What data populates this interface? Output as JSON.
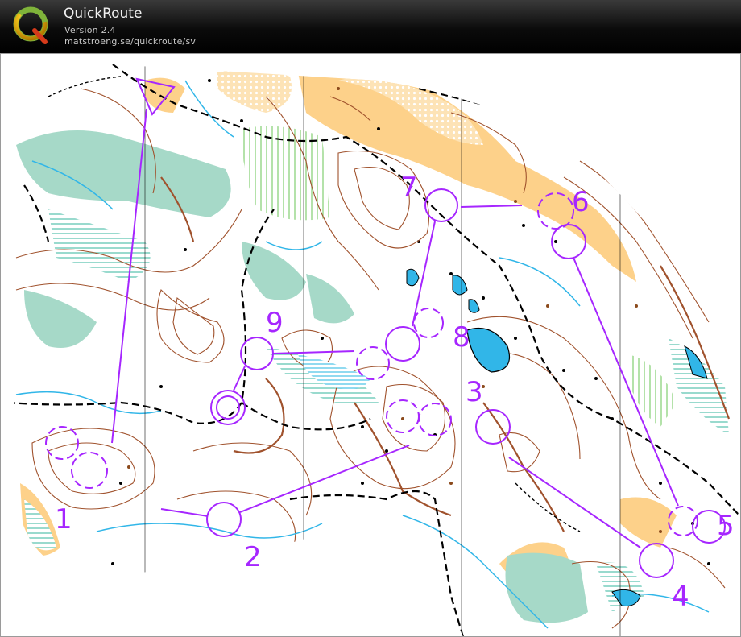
{
  "app": {
    "title": "QuickRoute",
    "version": "Version 2.4",
    "url": "matstroeng.se/quickroute/sv",
    "logo_letter": "Q"
  },
  "colors": {
    "header": "#000000",
    "course": "#a626ff",
    "contour": "#a0522d",
    "yellow": "#fdd18a",
    "green": "#a6d9c8",
    "water": "#31b6e8",
    "trail": "#000000"
  },
  "course": {
    "controls": [
      {
        "number": "1"
      },
      {
        "number": "2"
      },
      {
        "number": "3"
      },
      {
        "number": "4"
      },
      {
        "number": "5"
      },
      {
        "number": "6"
      },
      {
        "number": "7"
      },
      {
        "number": "8"
      },
      {
        "number": "9"
      }
    ],
    "has_start_triangle": true,
    "has_finish_circle": true
  }
}
